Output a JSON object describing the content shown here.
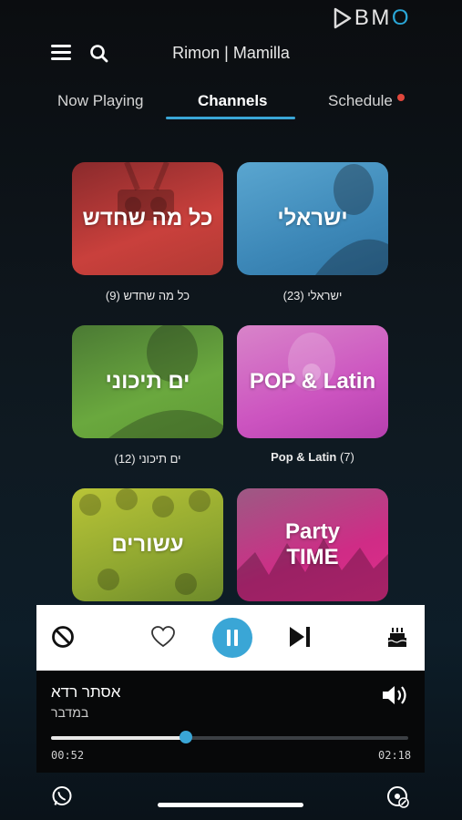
{
  "brand": {
    "logo_b": "B",
    "logo_m": "M",
    "logo_o": "O"
  },
  "header": {
    "title": "Rimon | Mamilla"
  },
  "tabs": [
    {
      "label": "Now Playing"
    },
    {
      "label": "Channels"
    },
    {
      "label": "Schedule"
    }
  ],
  "channels": [
    {
      "tile_text": "כל מה שחדש",
      "caption_name": "כל מה שחדש",
      "count": "(9)",
      "color": "#c9403c"
    },
    {
      "tile_text": "ישראלי",
      "caption_name": "ישראלי",
      "count": "(23)",
      "color": "#3d88b8"
    },
    {
      "tile_text": "ים תיכוני",
      "caption_name": "ים תיכוני",
      "count": "(12)",
      "color": "#6aa83e"
    },
    {
      "tile_text": "POP & Latin",
      "caption_name": "Pop & Latin",
      "count": "(7)",
      "color": "#cc54c0"
    },
    {
      "tile_text": "עשורים",
      "color": "#8ea630"
    },
    {
      "tile_text_line1": "Party",
      "tile_text_line2": "TIME",
      "color": "#cf2c86"
    }
  ],
  "player": {
    "track_title": "אסתר רדא",
    "track_artist": "במדבר",
    "elapsed": "00:52",
    "total": "02:18",
    "progress": 0.377
  },
  "colors": {
    "accent": "#3aa6d6",
    "schedule_badge": "#e0473c"
  }
}
